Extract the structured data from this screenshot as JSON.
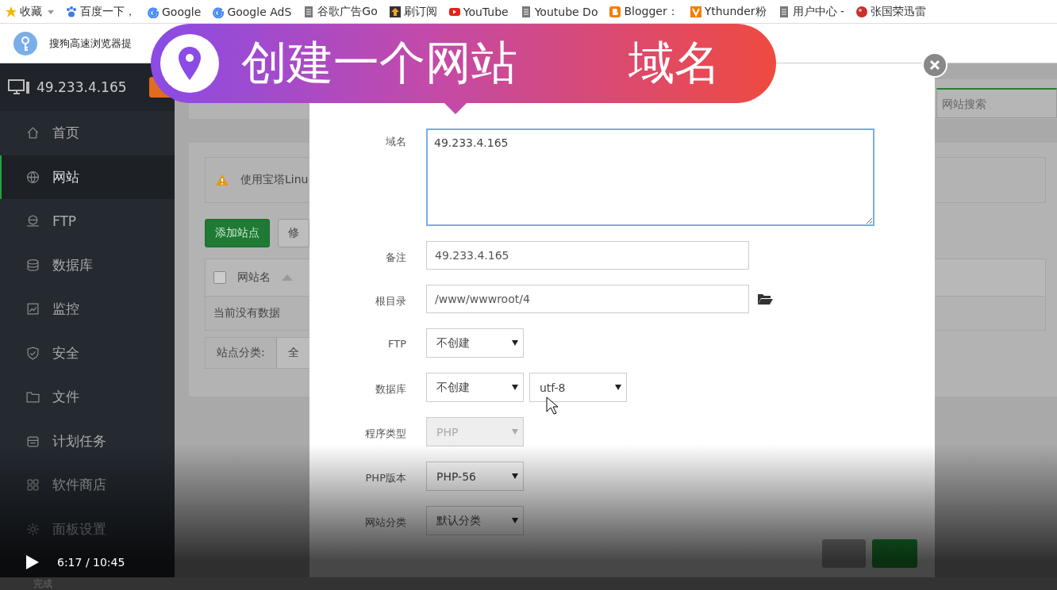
{
  "bookmarks": [
    {
      "label": "收藏",
      "kind": "star"
    },
    {
      "label": "百度一下，",
      "kind": "paw"
    },
    {
      "label": "Google",
      "kind": "google"
    },
    {
      "label": "Google AdS",
      "kind": "google"
    },
    {
      "label": "谷歌广告Go",
      "kind": "page"
    },
    {
      "label": "刷订阅",
      "kind": "arrow"
    },
    {
      "label": "YouTube",
      "kind": "youtube"
    },
    {
      "label": "Youtube Do",
      "kind": "page"
    },
    {
      "label": "Blogger：",
      "kind": "blogger"
    },
    {
      "label": "Ythunder粉",
      "kind": "v"
    },
    {
      "label": "用户中心 -",
      "kind": "page"
    },
    {
      "label": "张国荣迅雷",
      "kind": "ball"
    }
  ],
  "notification": {
    "text": "搜狗高速浏览器提"
  },
  "banner": {
    "title": "创建一个网站",
    "subtitle": "域名"
  },
  "sidebar": {
    "host": "49.233.4.165",
    "items": [
      {
        "label": "首页",
        "kind": "home",
        "selected": false
      },
      {
        "label": "网站",
        "kind": "globe",
        "selected": true
      },
      {
        "label": "FTP",
        "kind": "ftp",
        "selected": false
      },
      {
        "label": "数据库",
        "kind": "database",
        "selected": false
      },
      {
        "label": "监控",
        "kind": "monitor",
        "selected": false
      },
      {
        "label": "安全",
        "kind": "shield",
        "selected": false
      },
      {
        "label": "文件",
        "kind": "folder",
        "selected": false
      },
      {
        "label": "计划任务",
        "kind": "calendar",
        "selected": false
      },
      {
        "label": "软件商店",
        "kind": "grid",
        "selected": false
      },
      {
        "label": "面板设置",
        "kind": "gear",
        "selected": false
      }
    ]
  },
  "main": {
    "search": {
      "placeholder": "网站搜索"
    },
    "notice": "使用宝塔Linu",
    "buttons": [
      {
        "label": "添加站点",
        "kind": "primary"
      },
      {
        "label": "修",
        "kind": "default"
      }
    ],
    "table": {
      "select_all": {
        "checked": false
      },
      "columns": [
        "网站名"
      ],
      "empty": "当前没有数据"
    },
    "category": {
      "label": "站点分类:",
      "value": "全"
    }
  },
  "modal": {
    "fields": [
      {
        "label": "域名",
        "kind": "textarea",
        "value": "49.233.4.165"
      },
      {
        "label": "备注",
        "kind": "text",
        "value": "49.233.4.165"
      },
      {
        "label": "根目录",
        "kind": "path",
        "value": "/www/wwwroot/4"
      },
      {
        "label": "FTP",
        "kind": "select",
        "selects": [
          {
            "value": "不创建",
            "disabled": false
          }
        ]
      },
      {
        "label": "数据库",
        "kind": "select",
        "selects": [
          {
            "value": "不创建",
            "disabled": false
          },
          {
            "value": "utf-8",
            "disabled": false
          }
        ]
      },
      {
        "label": "程序类型",
        "kind": "select",
        "selects": [
          {
            "value": "PHP",
            "disabled": true
          }
        ]
      },
      {
        "label": "PHP版本",
        "kind": "select",
        "selects": [
          {
            "value": "PHP-56",
            "disabled": false
          }
        ]
      },
      {
        "label": "网站分类",
        "kind": "select",
        "selects": [
          {
            "value": "默认分类",
            "disabled": false
          }
        ]
      }
    ]
  },
  "player": {
    "time": "6:17 / 10:45",
    "status": "完成"
  }
}
